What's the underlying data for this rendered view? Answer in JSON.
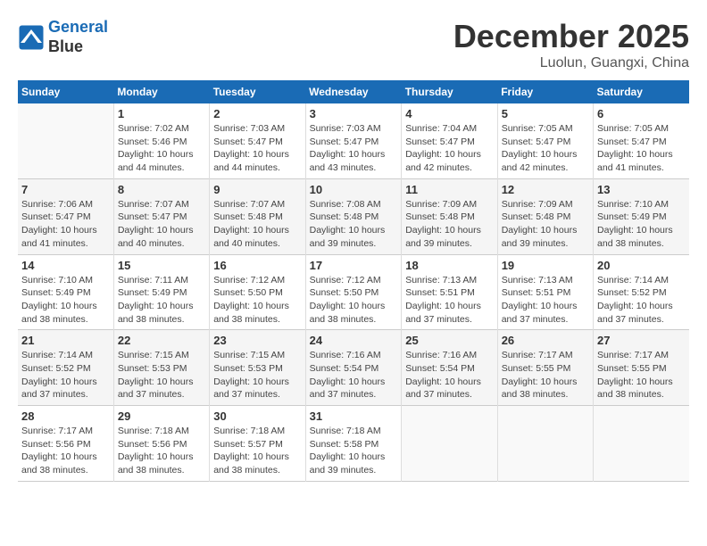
{
  "header": {
    "logo_line1": "General",
    "logo_line2": "Blue",
    "month": "December 2025",
    "location": "Luolun, Guangxi, China"
  },
  "weekdays": [
    "Sunday",
    "Monday",
    "Tuesday",
    "Wednesday",
    "Thursday",
    "Friday",
    "Saturday"
  ],
  "weeks": [
    [
      {
        "day": "",
        "info": ""
      },
      {
        "day": "1",
        "info": "Sunrise: 7:02 AM\nSunset: 5:46 PM\nDaylight: 10 hours\nand 44 minutes."
      },
      {
        "day": "2",
        "info": "Sunrise: 7:03 AM\nSunset: 5:47 PM\nDaylight: 10 hours\nand 44 minutes."
      },
      {
        "day": "3",
        "info": "Sunrise: 7:03 AM\nSunset: 5:47 PM\nDaylight: 10 hours\nand 43 minutes."
      },
      {
        "day": "4",
        "info": "Sunrise: 7:04 AM\nSunset: 5:47 PM\nDaylight: 10 hours\nand 42 minutes."
      },
      {
        "day": "5",
        "info": "Sunrise: 7:05 AM\nSunset: 5:47 PM\nDaylight: 10 hours\nand 42 minutes."
      },
      {
        "day": "6",
        "info": "Sunrise: 7:05 AM\nSunset: 5:47 PM\nDaylight: 10 hours\nand 41 minutes."
      }
    ],
    [
      {
        "day": "7",
        "info": "Sunrise: 7:06 AM\nSunset: 5:47 PM\nDaylight: 10 hours\nand 41 minutes."
      },
      {
        "day": "8",
        "info": "Sunrise: 7:07 AM\nSunset: 5:47 PM\nDaylight: 10 hours\nand 40 minutes."
      },
      {
        "day": "9",
        "info": "Sunrise: 7:07 AM\nSunset: 5:48 PM\nDaylight: 10 hours\nand 40 minutes."
      },
      {
        "day": "10",
        "info": "Sunrise: 7:08 AM\nSunset: 5:48 PM\nDaylight: 10 hours\nand 39 minutes."
      },
      {
        "day": "11",
        "info": "Sunrise: 7:09 AM\nSunset: 5:48 PM\nDaylight: 10 hours\nand 39 minutes."
      },
      {
        "day": "12",
        "info": "Sunrise: 7:09 AM\nSunset: 5:48 PM\nDaylight: 10 hours\nand 39 minutes."
      },
      {
        "day": "13",
        "info": "Sunrise: 7:10 AM\nSunset: 5:49 PM\nDaylight: 10 hours\nand 38 minutes."
      }
    ],
    [
      {
        "day": "14",
        "info": "Sunrise: 7:10 AM\nSunset: 5:49 PM\nDaylight: 10 hours\nand 38 minutes."
      },
      {
        "day": "15",
        "info": "Sunrise: 7:11 AM\nSunset: 5:49 PM\nDaylight: 10 hours\nand 38 minutes."
      },
      {
        "day": "16",
        "info": "Sunrise: 7:12 AM\nSunset: 5:50 PM\nDaylight: 10 hours\nand 38 minutes."
      },
      {
        "day": "17",
        "info": "Sunrise: 7:12 AM\nSunset: 5:50 PM\nDaylight: 10 hours\nand 38 minutes."
      },
      {
        "day": "18",
        "info": "Sunrise: 7:13 AM\nSunset: 5:51 PM\nDaylight: 10 hours\nand 37 minutes."
      },
      {
        "day": "19",
        "info": "Sunrise: 7:13 AM\nSunset: 5:51 PM\nDaylight: 10 hours\nand 37 minutes."
      },
      {
        "day": "20",
        "info": "Sunrise: 7:14 AM\nSunset: 5:52 PM\nDaylight: 10 hours\nand 37 minutes."
      }
    ],
    [
      {
        "day": "21",
        "info": "Sunrise: 7:14 AM\nSunset: 5:52 PM\nDaylight: 10 hours\nand 37 minutes."
      },
      {
        "day": "22",
        "info": "Sunrise: 7:15 AM\nSunset: 5:53 PM\nDaylight: 10 hours\nand 37 minutes."
      },
      {
        "day": "23",
        "info": "Sunrise: 7:15 AM\nSunset: 5:53 PM\nDaylight: 10 hours\nand 37 minutes."
      },
      {
        "day": "24",
        "info": "Sunrise: 7:16 AM\nSunset: 5:54 PM\nDaylight: 10 hours\nand 37 minutes."
      },
      {
        "day": "25",
        "info": "Sunrise: 7:16 AM\nSunset: 5:54 PM\nDaylight: 10 hours\nand 37 minutes."
      },
      {
        "day": "26",
        "info": "Sunrise: 7:17 AM\nSunset: 5:55 PM\nDaylight: 10 hours\nand 38 minutes."
      },
      {
        "day": "27",
        "info": "Sunrise: 7:17 AM\nSunset: 5:55 PM\nDaylight: 10 hours\nand 38 minutes."
      }
    ],
    [
      {
        "day": "28",
        "info": "Sunrise: 7:17 AM\nSunset: 5:56 PM\nDaylight: 10 hours\nand 38 minutes."
      },
      {
        "day": "29",
        "info": "Sunrise: 7:18 AM\nSunset: 5:56 PM\nDaylight: 10 hours\nand 38 minutes."
      },
      {
        "day": "30",
        "info": "Sunrise: 7:18 AM\nSunset: 5:57 PM\nDaylight: 10 hours\nand 38 minutes."
      },
      {
        "day": "31",
        "info": "Sunrise: 7:18 AM\nSunset: 5:58 PM\nDaylight: 10 hours\nand 39 minutes."
      },
      {
        "day": "",
        "info": ""
      },
      {
        "day": "",
        "info": ""
      },
      {
        "day": "",
        "info": ""
      }
    ]
  ]
}
